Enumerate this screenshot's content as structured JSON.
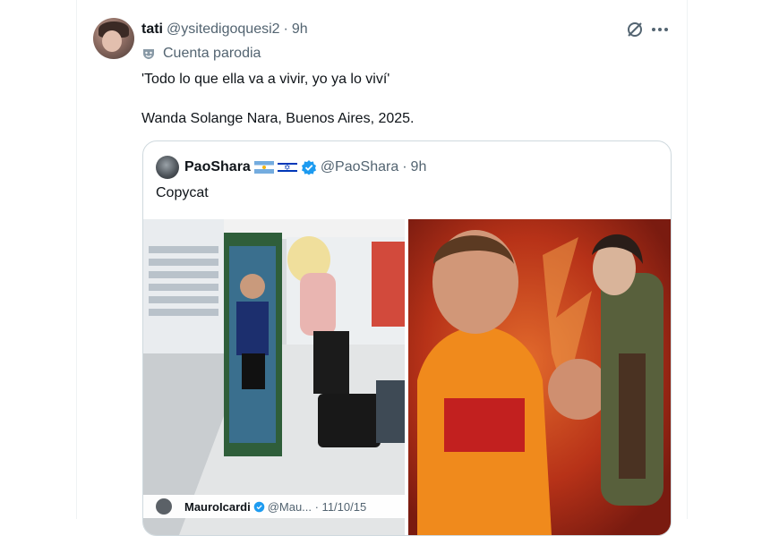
{
  "tweet": {
    "display_name": "tati",
    "handle": "@ysitedigoquesi2",
    "separator": "·",
    "time": "9h",
    "parody_label": "Cuenta parodia",
    "text_line1": "'Todo lo que ella va a vivir, yo ya lo viví'",
    "text_line2": "Wanda Solange Nara, Buenos Aires, 2025.",
    "icons": {
      "grok": "grok-icon",
      "more": "more-options-icon",
      "parody": "parody-mask-icon"
    }
  },
  "quote": {
    "display_name": "PaoShara",
    "flag_1": "argentina-flag",
    "flag_2": "israel-flag",
    "handle": "@PaoShara",
    "separator": "·",
    "time": "9h",
    "text": "Copycat",
    "media_left": {
      "caption_name": "MauroIcardi",
      "caption_rest": "@Mau... · 11/10/15"
    },
    "media_right": {}
  },
  "colors": {
    "text_primary": "#0f1419",
    "text_secondary": "#536471",
    "border": "#cfd9de",
    "verified_blue": "#1d9bf0"
  }
}
